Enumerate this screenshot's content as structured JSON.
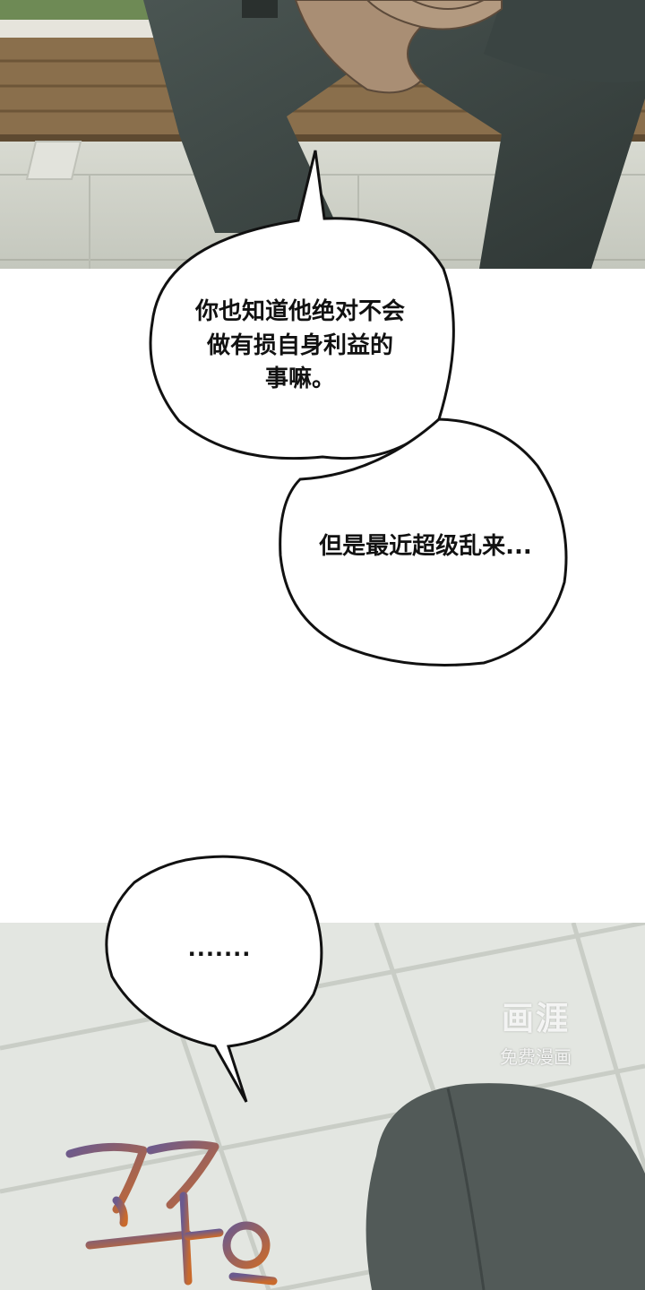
{
  "bubbles": [
    {
      "text": "你也知道他绝对不会\n做有损自身利益的\n事嘛。"
    },
    {
      "text": "但是最近超级乱来..."
    },
    {
      "text": "......."
    }
  ],
  "watermark": {
    "logo": "画涯",
    "subtitle": "免费漫画"
  },
  "sfx": {
    "text": "꽈악"
  },
  "colors": {
    "suit": "#3e4745",
    "bench": "#8a6f4c",
    "pavement": "#cfd1c8",
    "bubble_fill": "#ffffff",
    "bubble_stroke": "#111111",
    "sfx_orange": "#c96a2c",
    "sfx_purple": "#6b5a8e"
  }
}
